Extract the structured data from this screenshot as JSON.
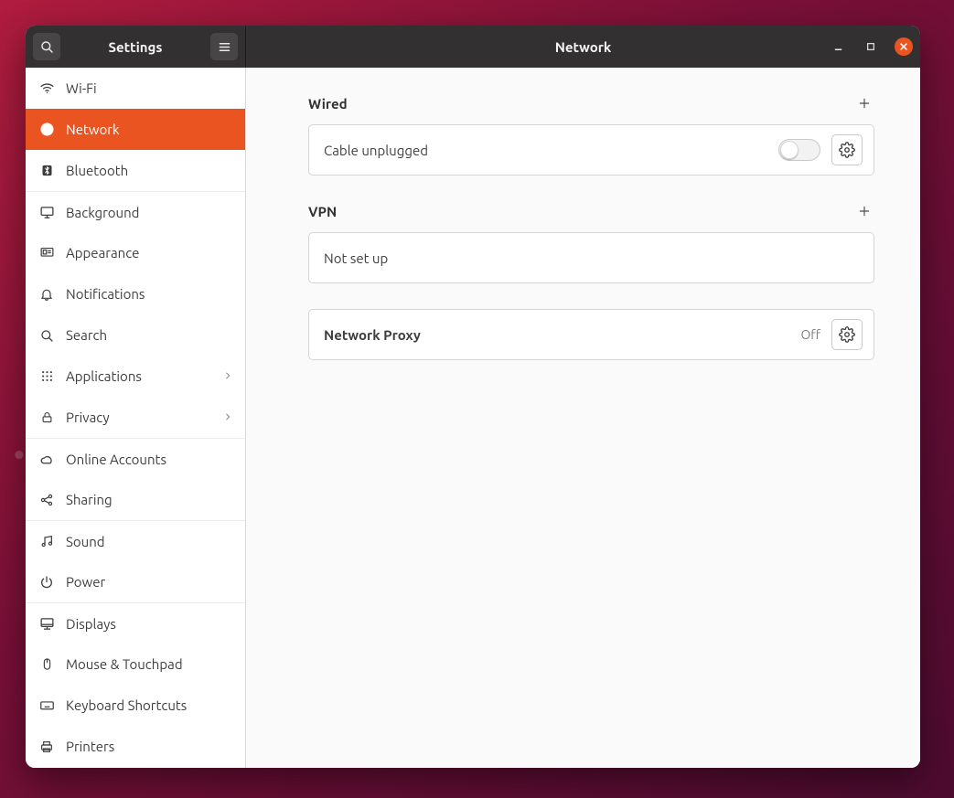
{
  "titlebar": {
    "left_title": "Settings",
    "right_title": "Network"
  },
  "sidebar": {
    "items": [
      {
        "label": "Wi-Fi"
      },
      {
        "label": "Network"
      },
      {
        "label": "Bluetooth"
      },
      {
        "label": "Background"
      },
      {
        "label": "Appearance"
      },
      {
        "label": "Notifications"
      },
      {
        "label": "Search"
      },
      {
        "label": "Applications"
      },
      {
        "label": "Privacy"
      },
      {
        "label": "Online Accounts"
      },
      {
        "label": "Sharing"
      },
      {
        "label": "Sound"
      },
      {
        "label": "Power"
      },
      {
        "label": "Displays"
      },
      {
        "label": "Mouse & Touchpad"
      },
      {
        "label": "Keyboard Shortcuts"
      },
      {
        "label": "Printers"
      }
    ]
  },
  "content": {
    "wired": {
      "title": "Wired",
      "status": "Cable unplugged"
    },
    "vpn": {
      "title": "VPN",
      "status": "Not set up"
    },
    "proxy": {
      "title": "Network Proxy",
      "status": "Off"
    }
  },
  "colors": {
    "accent": "#e95420"
  }
}
